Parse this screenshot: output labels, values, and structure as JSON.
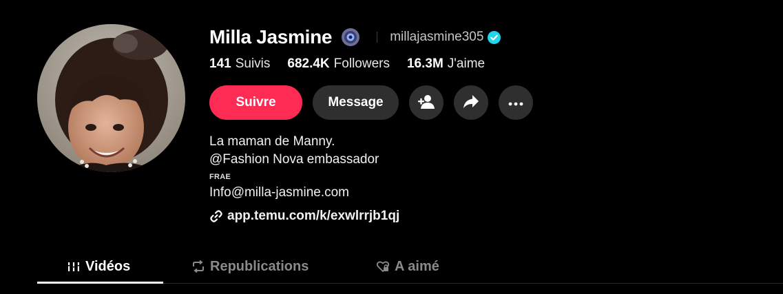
{
  "profile": {
    "display_name": "Milla Jasmine",
    "username": "millajasmine305"
  },
  "stats": [
    {
      "value": "141",
      "label": "Suivis"
    },
    {
      "value": "682.4K",
      "label": "Followers"
    },
    {
      "value": "16.3M",
      "label": "J'aime"
    }
  ],
  "actions": {
    "follow_label": "Suivre",
    "message_label": "Message"
  },
  "bio": {
    "lines": [
      "La maman de Manny.",
      "@Fashion Nova embassador"
    ],
    "region": "FRAE",
    "email": "Info@milla-jasmine.com",
    "link": "app.temu.com/k/exwlrrjb1qj"
  },
  "tabs": [
    {
      "label": "Vidéos",
      "icon": "grid-bars-icon"
    },
    {
      "label": "Republications",
      "icon": "repost-icon"
    },
    {
      "label": "A aimé",
      "icon": "heart-lock-icon"
    }
  ],
  "colors": {
    "follow_button": "#fe2c55",
    "secondary_button": "#2f2f2f",
    "verified_badge": "#20d5ec",
    "background": "#000000"
  }
}
